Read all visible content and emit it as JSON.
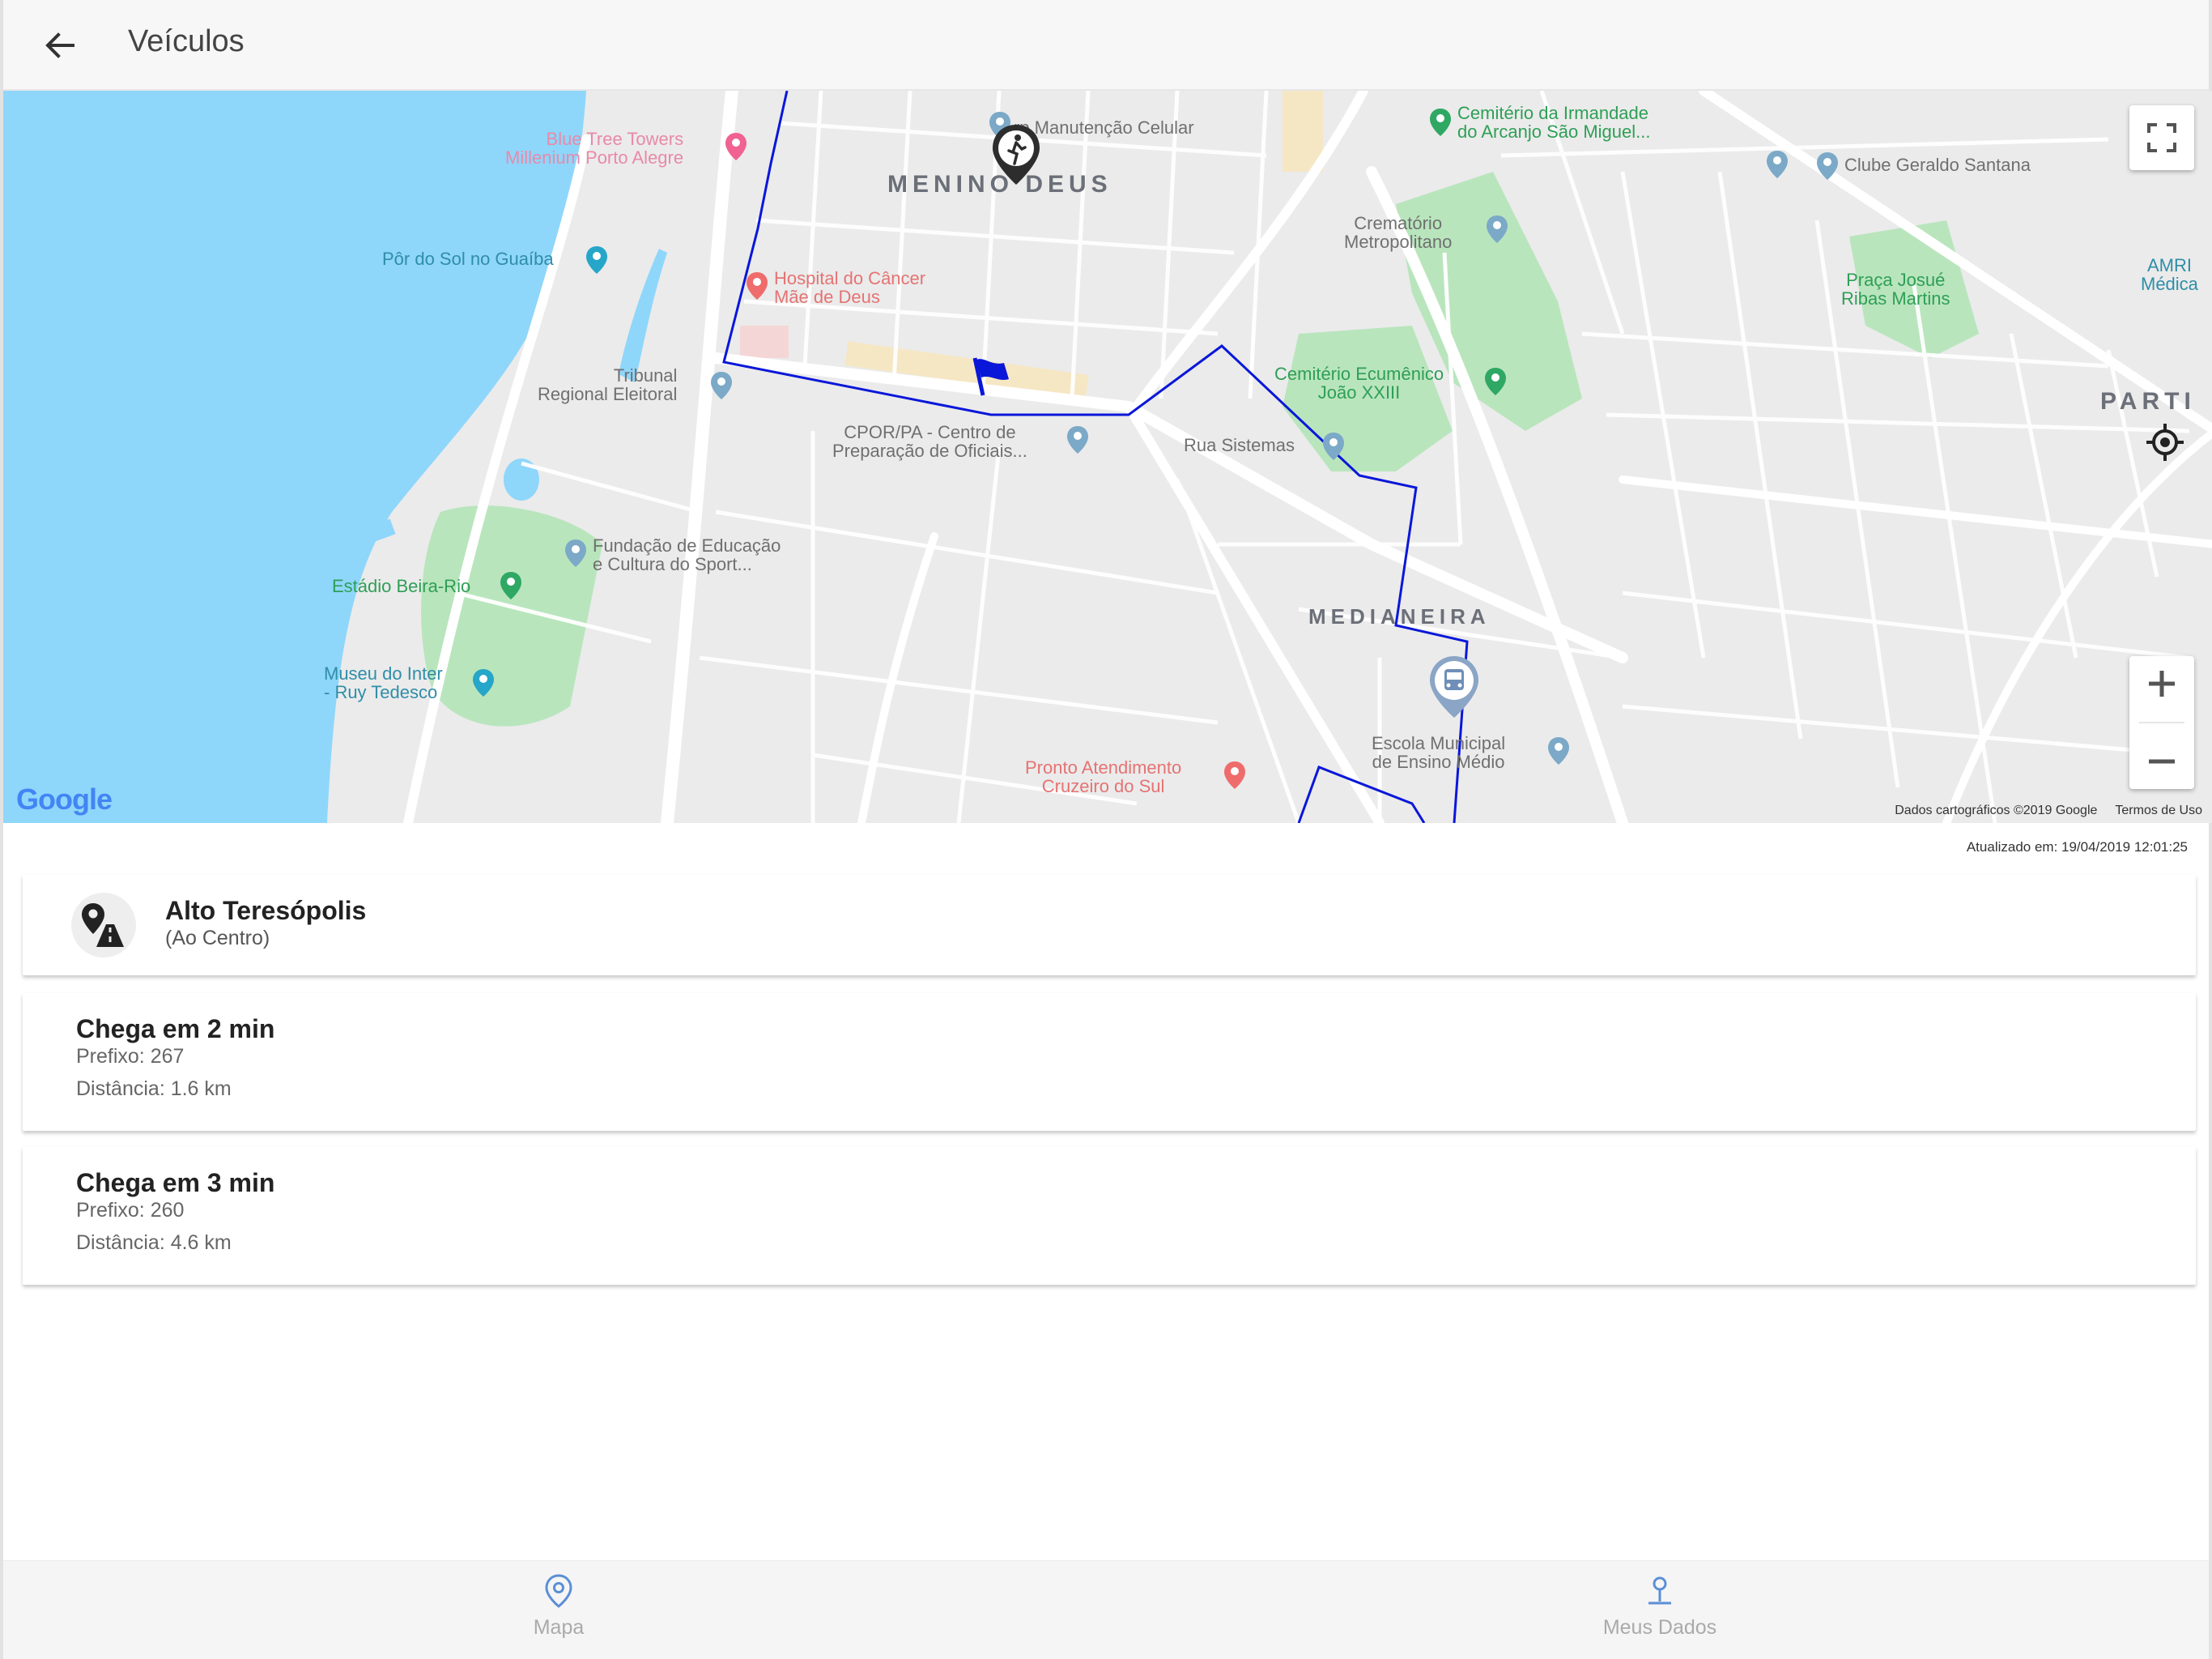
{
  "header": {
    "title": "Veículos",
    "back_icon": "arrow-left-icon"
  },
  "map": {
    "neighborhoods": [
      "MENINO DEUS",
      "MEDIANEIRA",
      "PARTI"
    ],
    "pois": [
      {
        "name": "Blue Tree Towers\nMillenium Porto Alegre",
        "kind": "hotel"
      },
      {
        "name": "Pôr do Sol no Guaíba",
        "kind": "attraction"
      },
      {
        "name": "Hospital do Câncer\nMãe de Deus",
        "kind": "hospital"
      },
      {
        "name": "Tribunal\nRegional Eleitoral",
        "kind": "government"
      },
      {
        "name": "CPOR/PA - Centro de\nPreparação de Oficiais...",
        "kind": "government"
      },
      {
        "name": "Fundação de Educação\ne Cultura do Sport...",
        "kind": "place"
      },
      {
        "name": "Estádio Beira-Rio",
        "kind": "stadium"
      },
      {
        "name": "Museu do Inter\n- Ruy Tedesco",
        "kind": "museum"
      },
      {
        "name": "Cemitério da Irmandade\ndo Arcanjo São Miguel...",
        "kind": "cemetery"
      },
      {
        "name": "Crematório\nMetropolitano",
        "kind": "place"
      },
      {
        "name": "Clube Geraldo Santana",
        "kind": "place"
      },
      {
        "name": "Praça Josué\nRibas Martins",
        "kind": "park"
      },
      {
        "name": "AMRI\nMédica",
        "kind": "place"
      },
      {
        "name": "Cemitério Ecumênico\nJoão XXIII",
        "kind": "cemetery"
      },
      {
        "name": "Rua Sistemas",
        "kind": "place"
      },
      {
        "name": "Escola Municipal\nde Ensino Médio",
        "kind": "school"
      },
      {
        "name": "Pronto Atendimento\nCruzeiro do Sul",
        "kind": "hospital"
      },
      {
        "name": "rp Manutenção Celular",
        "kind": "place"
      }
    ],
    "google_logo": "Google",
    "attribution": "Dados cartográficos ©2019 Google",
    "terms": "Termos de Uso",
    "colors": {
      "water": "#8fd6fb",
      "land": "#ebebeb",
      "road": "#ffffff",
      "park": "#b9e5bd",
      "route": "#0a17d9"
    }
  },
  "updated_text": "Atualizado em: 19/04/2019 12:01:25",
  "route": {
    "name": "Alto Teresópolis",
    "direction": "(Ao Centro)",
    "icon": "route-pin-icon"
  },
  "vehicles": [
    {
      "title": "Chega em 2 min",
      "prefix": "Prefixo: 267",
      "distance": "Distância: 1.6 km"
    },
    {
      "title": "Chega em 3 min",
      "prefix": "Prefixo: 260",
      "distance": "Distância: 4.6 km"
    }
  ],
  "bottom_nav": {
    "items": [
      {
        "label": "Mapa",
        "icon": "map-pin-icon"
      },
      {
        "label": "Meus Dados",
        "icon": "person-icon"
      }
    ],
    "icon_color": "#5b8fd6"
  }
}
